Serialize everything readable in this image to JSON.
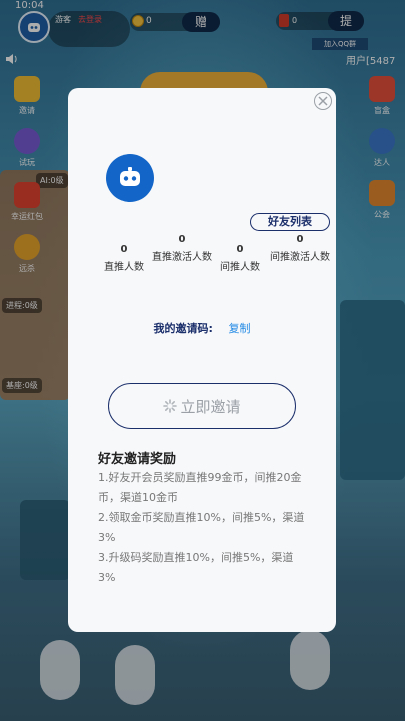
{
  "status": {
    "time": "10:04"
  },
  "header": {
    "guest_label": "游客",
    "login_link": "去登录",
    "coins": "0",
    "gift_button": "赠",
    "cash": "0",
    "withdraw_button": "提",
    "qq_group": "加入QQ群",
    "user_id": "用户[5487"
  },
  "left_sidebar": [
    {
      "label": "邀请",
      "icon": "invite-icon"
    },
    {
      "label": "试玩",
      "icon": "gamepad-icon"
    },
    {
      "label": "幸运红包",
      "icon": "red-envelope-icon"
    },
    {
      "label": "远杀",
      "icon": "coin-stack-icon"
    }
  ],
  "right_sidebar": [
    {
      "label": "盲盒",
      "icon": "blind-box-icon"
    },
    {
      "label": "达人",
      "icon": "expert-icon"
    },
    {
      "label": "公会",
      "icon": "guild-icon"
    }
  ],
  "levels": {
    "ai": "AI:0级",
    "progress": "进程:0级",
    "base": "基座:0级"
  },
  "modal": {
    "friend_list_button": "好友列表",
    "stats": [
      {
        "value": "0",
        "label": "直推人数"
      },
      {
        "value": "0",
        "label": "直推激活人数"
      },
      {
        "value": "0",
        "label": "间推人数"
      },
      {
        "value": "0",
        "label": "间推激活人数"
      }
    ],
    "invite_code_label": "我的邀请码:",
    "copy_link": "复制",
    "invite_button": "立即邀请",
    "reward_title": "好友邀请奖励",
    "rules": [
      "1.好友开会员奖励直推99金币，间推20金币，渠道10金币",
      "2.领取金币奖励直推10%，间推5%，渠道3%",
      "3.升级码奖励直推10%，间推5%，渠道3%"
    ]
  },
  "colors": {
    "accent": "#1b2f6b",
    "link": "#1e88e5",
    "login": "#ff4a4a"
  }
}
